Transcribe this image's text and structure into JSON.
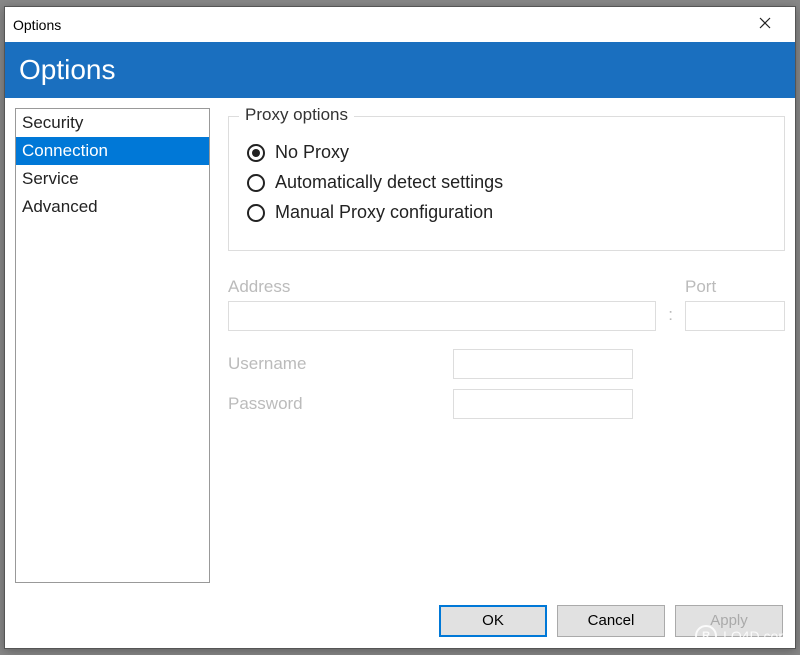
{
  "window": {
    "title": "Options"
  },
  "header": {
    "title": "Options"
  },
  "sidebar": {
    "items": [
      {
        "label": "Security",
        "selected": false
      },
      {
        "label": "Connection",
        "selected": true
      },
      {
        "label": "Service",
        "selected": false
      },
      {
        "label": "Advanced",
        "selected": false
      }
    ]
  },
  "proxy": {
    "group_title": "Proxy options",
    "options": {
      "no_proxy": "No Proxy",
      "auto_detect": "Automatically detect settings",
      "manual": "Manual Proxy configuration"
    },
    "selected": "no_proxy"
  },
  "fields": {
    "address_label": "Address",
    "port_label": "Port",
    "username_label": "Username",
    "password_label": "Password",
    "address_value": "",
    "port_value": "",
    "username_value": "",
    "password_value": "",
    "separator": ":"
  },
  "buttons": {
    "ok": "OK",
    "cancel": "Cancel",
    "apply": "Apply"
  },
  "watermark": {
    "text": "LO4D.com",
    "icon": "R"
  }
}
